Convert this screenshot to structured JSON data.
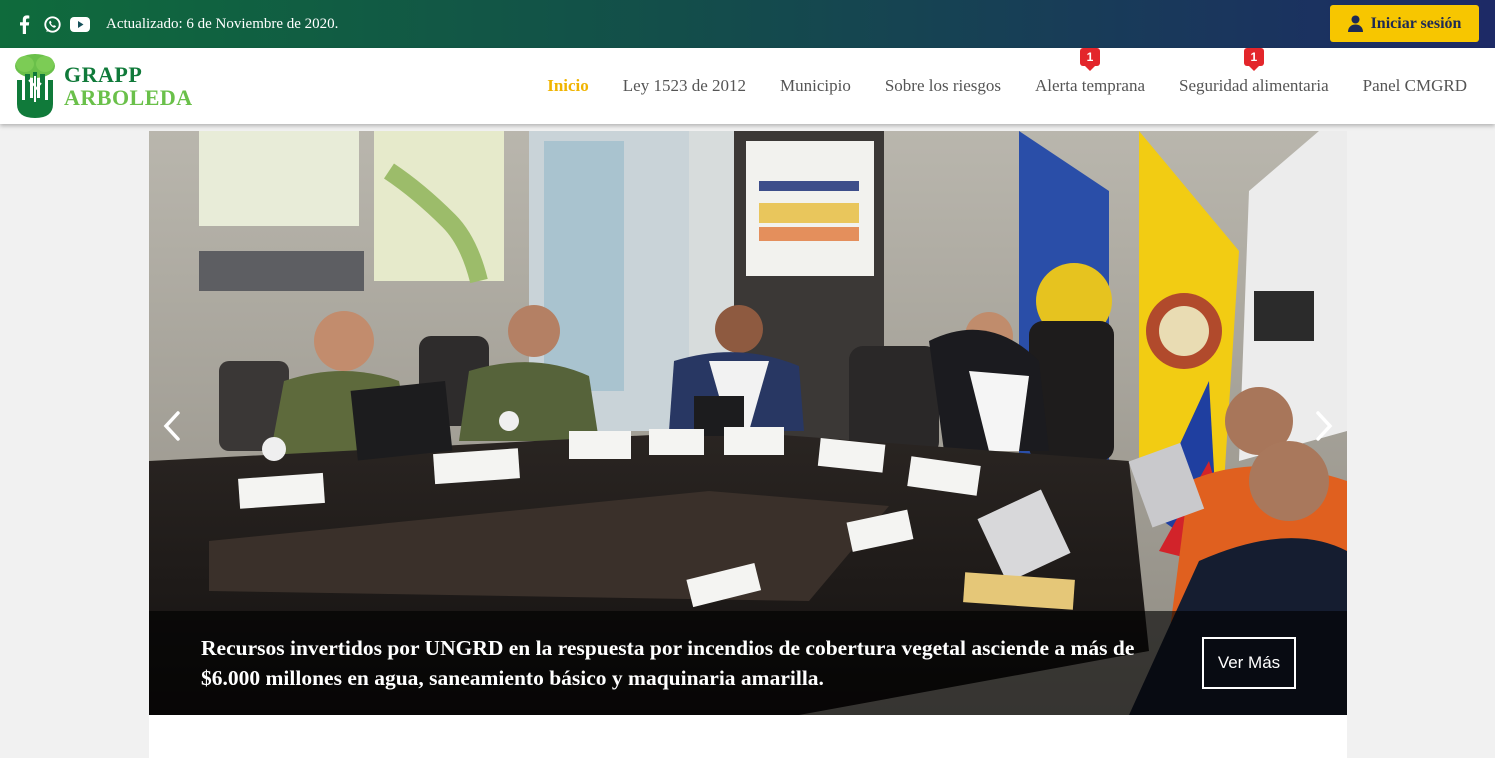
{
  "topbar": {
    "social_icons": [
      "facebook-icon",
      "whatsapp-icon",
      "youtube-icon"
    ],
    "updated_text": "Actualizado: 6 de Noviembre de 2020.",
    "login_label": "Iniciar sesión",
    "login_icon": "user-icon",
    "colors": {
      "gradient_start": "#0f6b3c",
      "gradient_end": "#1d2a66",
      "login_bg": "#f7c600"
    }
  },
  "logo": {
    "line1": "GRAPP",
    "line2": "ARBOLEDA",
    "colors": {
      "line1": "#107a3a",
      "line2": "#6ac04a"
    }
  },
  "nav": {
    "items": [
      {
        "label": "Inicio",
        "active": true
      },
      {
        "label": "Ley 1523 de 2012"
      },
      {
        "label": "Municipio"
      },
      {
        "label": "Sobre los riesgos"
      },
      {
        "label": "Alerta temprana",
        "badge": "1"
      },
      {
        "label": "Seguridad alimentaria",
        "badge": "1"
      },
      {
        "label": "Panel CMGRD"
      }
    ],
    "active_color": "#f0b400"
  },
  "slider": {
    "caption": "Recursos invertidos por UNGRD en la respuesta por incendios de cobertura vegetal asciende a más de $6.000 millones en agua, saneamiento básico y maquinaria amarilla.",
    "button_label": "Ver Más",
    "prev_icon": "chevron-left-icon",
    "next_icon": "chevron-right-icon",
    "photo": "meeting-room-photo"
  }
}
